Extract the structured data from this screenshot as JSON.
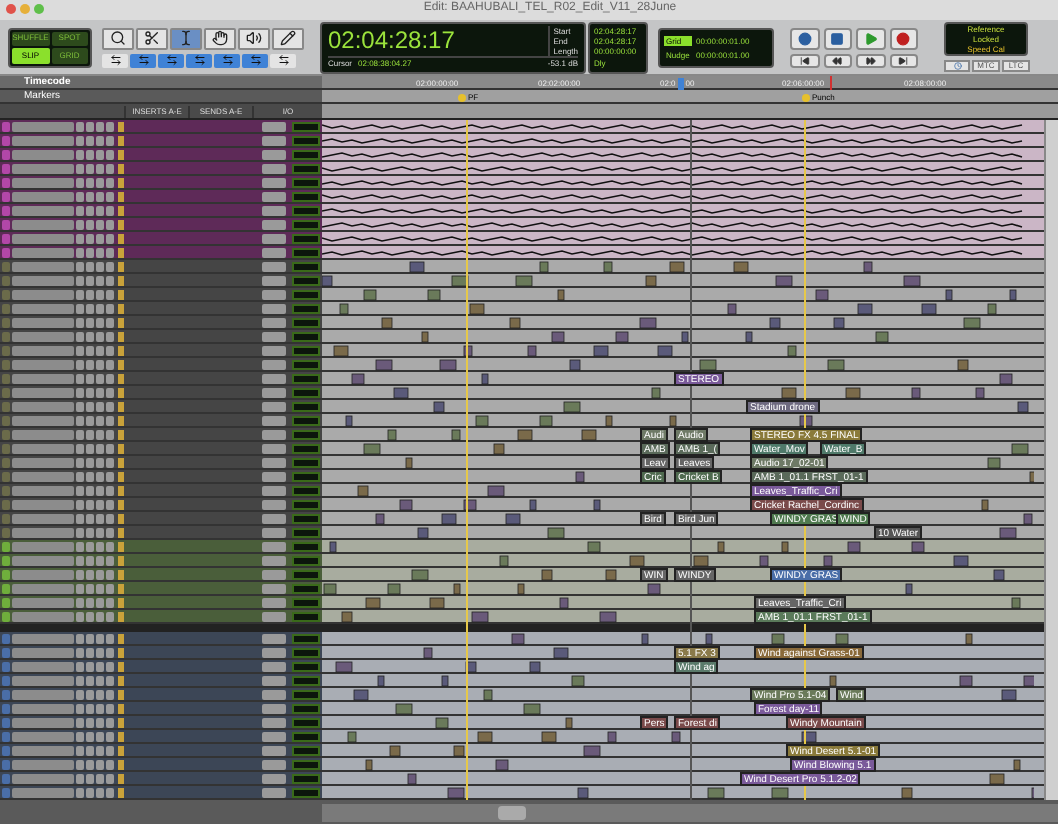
{
  "window": {
    "title": "Edit: BAAHUBALI_TEL_R02_Edit_V11_28June"
  },
  "edit_modes": [
    {
      "label": "SHUFFLE",
      "selected": false
    },
    {
      "label": "SPOT",
      "selected": false
    },
    {
      "label": "SLIP",
      "selected": true
    },
    {
      "label": "GRID",
      "selected": false
    }
  ],
  "edit_tools": [
    {
      "kind": "zoom",
      "selected": false
    },
    {
      "kind": "trim",
      "selected": false
    },
    {
      "kind": "selector",
      "selected": true
    },
    {
      "kind": "grabber",
      "selected": false
    },
    {
      "kind": "scrub",
      "selected": false
    },
    {
      "kind": "pencil",
      "selected": false
    }
  ],
  "main_counter": {
    "value": "02:04:28:17",
    "cursor_label": "Cursor",
    "cursor_value": "02:08:38:04.27",
    "reading": "-53.1 dB"
  },
  "selection": [
    {
      "label": "Start",
      "value": "02:04:28:17"
    },
    {
      "label": "End",
      "value": "02:04:28:17"
    },
    {
      "label": "Length",
      "value": "00:00:00:00"
    }
  ],
  "delay": {
    "label": "Dly"
  },
  "grid": {
    "label": "Grid",
    "value": "00:00:00:01.00"
  },
  "nudge": {
    "label": "Nudge",
    "value": "00:00:00:01.00"
  },
  "transport": [
    {
      "kind": "online"
    },
    {
      "kind": "stop"
    },
    {
      "kind": "play"
    },
    {
      "kind": "record"
    },
    {
      "kind": "start"
    },
    {
      "kind": "rewind"
    },
    {
      "kind": "forward"
    },
    {
      "kind": "end"
    }
  ],
  "sync": {
    "lines": [
      "Reference",
      "Locked",
      "Speed Cal"
    ],
    "buttons": [
      "MTC",
      "LTC"
    ]
  },
  "rulers": {
    "timecode": {
      "name": "Timecode",
      "ticks": [
        {
          "label": "02:00:00:00"
        },
        {
          "label": "02:02:00:00"
        },
        {
          "label": "02:0",
          "tail": "00"
        },
        {
          "label": "02:06:00:00"
        },
        {
          "label": "02:08:00:00"
        }
      ]
    },
    "markers": {
      "name": "Markers",
      "items": [
        "PF",
        "Punch"
      ]
    }
  },
  "column_headers": [
    "INSERTS A-E",
    "SENDS A-E",
    "I/O"
  ],
  "track_groups": [
    {
      "kind": "automation",
      "color": "#b247a8"
    },
    {
      "kind": "audio",
      "color": "#6b6b4a"
    },
    {
      "kind": "audio",
      "color": "#6fae3c"
    },
    {
      "kind": "audio",
      "color": "#4a6ea8"
    }
  ],
  "lanes": [
    {
      "clips": [
        {
          "label": "STEREO",
          "color": "#7a5a9a"
        }
      ]
    },
    {
      "clips": [
        {
          "label": "Stadium drone",
          "color": "#6e6a80"
        }
      ]
    },
    {
      "clips": [
        {
          "label": "Audi",
          "color": "#6e7a66"
        },
        {
          "label": "Audio",
          "color": "#6e7a66"
        },
        {
          "label": "STEREO FX 4.5 FINAL",
          "color": "#8a7a3a"
        }
      ]
    },
    {
      "clips": [
        {
          "label": "AMB",
          "color": "#5a6a5a"
        },
        {
          "label": "AMB 1_(",
          "color": "#5a6a5a"
        },
        {
          "label": "Water_Mov",
          "color": "#4f7a6a"
        },
        {
          "label": "Water_B",
          "color": "#4f7a6a"
        }
      ]
    },
    {
      "clips": [
        {
          "label": "Leav",
          "color": "#666666"
        },
        {
          "label": "Leaves",
          "color": "#666666"
        },
        {
          "label": "Audio 17_02-01",
          "color": "#6e7a66"
        }
      ]
    },
    {
      "clips": [
        {
          "label": "Cric",
          "color": "#4f6a4f"
        },
        {
          "label": "Cricket B",
          "color": "#4f6a4f"
        },
        {
          "label": "AMB 1_01.1 FRST_01-1",
          "color": "#5a6a5a"
        }
      ]
    },
    {
      "clips": [
        {
          "label": "Leaves_Traffic_Cri",
          "color": "#7a5a9a"
        }
      ]
    },
    {
      "clips": [
        {
          "label": "Cricket Rachel_Cordinc",
          "color": "#7a4a4a"
        }
      ]
    },
    {
      "clips": [
        {
          "label": "Bird",
          "color": "#666666"
        },
        {
          "label": "Bird Jun",
          "color": "#666666"
        },
        {
          "label": "WINDY GRAS",
          "color": "#4f7a4f"
        },
        {
          "label": "WIND",
          "color": "#4f7a4f"
        }
      ]
    },
    {
      "clips": [
        {
          "label": "10 Water",
          "color": "#555555"
        }
      ]
    },
    {
      "clips": [
        {
          "label": "WIN",
          "color": "#666666"
        },
        {
          "label": "WINDY",
          "color": "#666666"
        },
        {
          "label": "WINDY GRAS",
          "color": "#4a6ea8"
        }
      ]
    },
    {
      "clips": [
        {
          "label": "Leaves_Traffic_Cri",
          "color": "#666666"
        }
      ]
    },
    {
      "clips": [
        {
          "label": "AMB 1_01.1 FRST_01-1",
          "color": "#5a7a5a"
        }
      ]
    },
    {
      "clips": [
        {
          "label": "5.1 FX 3",
          "color": "#8a7a4a"
        },
        {
          "label": "Wind against Grass-01",
          "color": "#8a6a3a"
        }
      ]
    },
    {
      "clips": [
        {
          "label": "Wind ag",
          "color": "#5a7a6a"
        }
      ]
    },
    {
      "clips": [
        {
          "label": "Wind Pro 5.1-04",
          "color": "#6a7a5a"
        },
        {
          "label": "Wind",
          "color": "#6a7a5a"
        }
      ]
    },
    {
      "clips": [
        {
          "label": "Forest day-11",
          "color": "#7a5a9a"
        }
      ]
    },
    {
      "clips": [
        {
          "label": "Pers",
          "color": "#7a4a4a"
        },
        {
          "label": "Forest di",
          "color": "#7a4a4a"
        },
        {
          "label": "Windy Mountain",
          "color": "#7a4a4a"
        }
      ]
    },
    {
      "clips": [
        {
          "label": "Wind Desert 5.1-01",
          "color": "#8a7a3a"
        }
      ]
    },
    {
      "clips": [
        {
          "label": "Wind Blowing 5.1",
          "color": "#7a5a9a"
        }
      ]
    },
    {
      "clips": [
        {
          "label": "Wind Desert Pro 5.1.2-02",
          "color": "#7a5a9a"
        }
      ]
    }
  ]
}
